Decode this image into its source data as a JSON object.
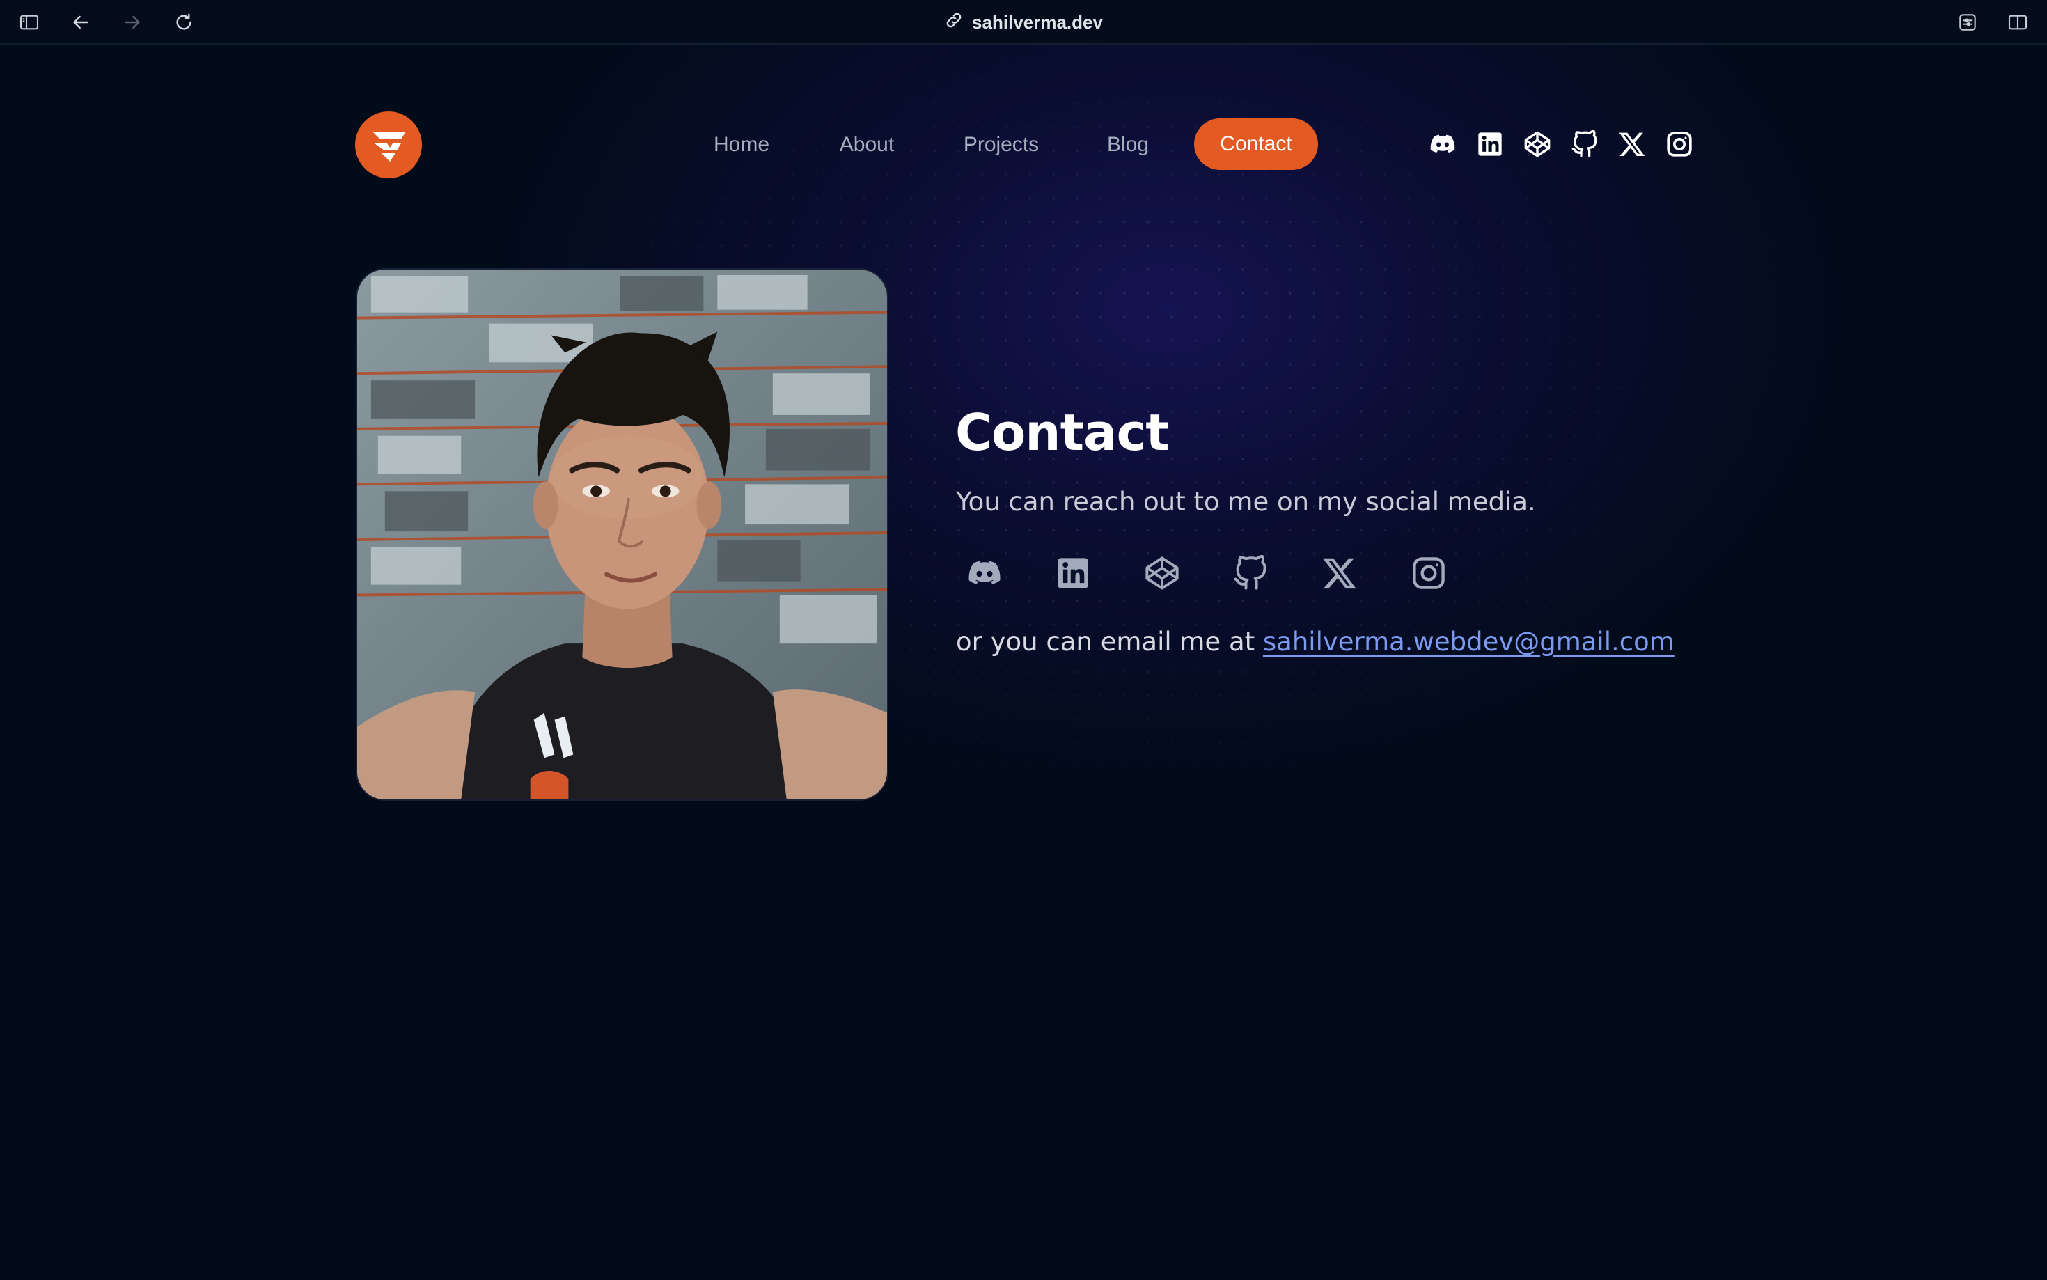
{
  "browser": {
    "url": "sahilverma.dev",
    "icons": [
      "sidebar-icon",
      "back-icon",
      "forward-icon",
      "reload-icon",
      "link-icon",
      "extension-icon",
      "split-view-icon"
    ]
  },
  "nav": {
    "items": [
      {
        "label": "Home",
        "active": false
      },
      {
        "label": "About",
        "active": false
      },
      {
        "label": "Projects",
        "active": false
      },
      {
        "label": "Blog",
        "active": false
      },
      {
        "label": "Contact",
        "active": true
      }
    ],
    "socials": [
      "discord-icon",
      "linkedin-icon",
      "codepen-icon",
      "github-icon",
      "x-icon",
      "instagram-icon"
    ]
  },
  "contact": {
    "title": "Contact",
    "subtitle": "You can reach out to me on my social media.",
    "email_prefix": "or you can email me at ",
    "email": "sahilverma.webdev@gmail.com"
  },
  "colors": {
    "accent": "#e35b22",
    "link": "#7b9af0",
    "background": "#020b1a"
  }
}
